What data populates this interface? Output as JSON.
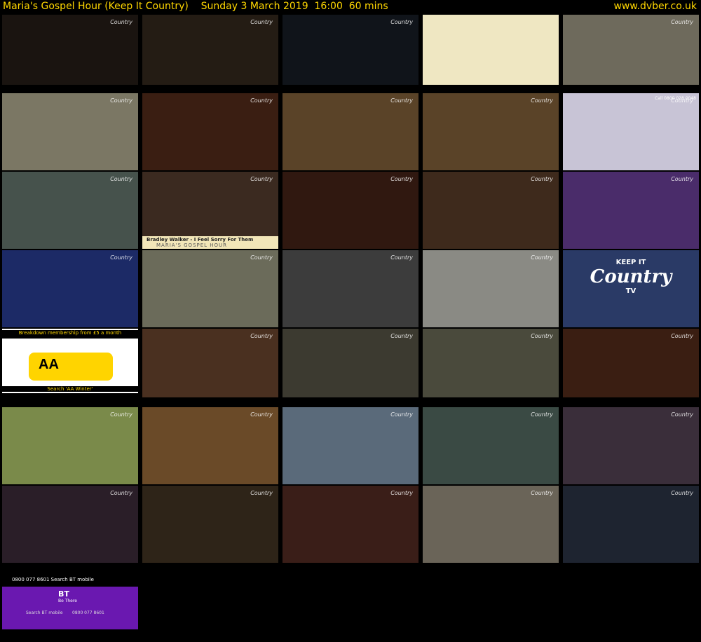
{
  "header": {
    "title": "Maria's Gospel Hour (Keep It Country)    Sunday 3 March 2019  16:00  60 mins",
    "site": "www.dvber.co.uk"
  },
  "channel_logo": "Country",
  "thumbnails": [
    {
      "name": "thumb-presenter-closeup",
      "bg": "#1a1410"
    },
    {
      "name": "thumb-guitarist-band",
      "bg": "#241c14"
    },
    {
      "name": "thumb-bass-player",
      "bg": "#10141a"
    },
    {
      "name": "thumb-bright-sunburst",
      "bg": "#efe7c2"
    },
    {
      "name": "thumb-man-rural-guitar",
      "bg": "#6e6a5c"
    },
    {
      "name": "thumb-couple-cottage",
      "bg": "#7b7764"
    },
    {
      "name": "thumb-maria-studio",
      "bg": "#3a1e12"
    },
    {
      "name": "thumb-singer-guitar",
      "bg": "#5a4328"
    },
    {
      "name": "thumb-singer-guitar-2",
      "bg": "#5a4328"
    },
    {
      "name": "thumb-advert-shelves",
      "bg": "#c8c4d6"
    },
    {
      "name": "thumb-child-hood",
      "bg": "#46524c"
    },
    {
      "name": "thumb-bradley-walker",
      "bg": "#3b2a20"
    },
    {
      "name": "thumb-singer-mic-red",
      "bg": "#301810"
    },
    {
      "name": "thumb-two-men-mic",
      "bg": "#3e2a1c"
    },
    {
      "name": "thumb-purple-guitar",
      "bg": "#4a2c6a"
    },
    {
      "name": "thumb-blue-guitar",
      "bg": "#1c2a66"
    },
    {
      "name": "thumb-old-man-outdoor",
      "bg": "#6b6b5a"
    },
    {
      "name": "thumb-bw-portrait",
      "bg": "#3c3c3c"
    },
    {
      "name": "thumb-bw-bench",
      "bg": "#8a8a84"
    },
    {
      "name": "thumb-keep-it-country-ident",
      "bg": "#2a3a66"
    },
    {
      "name": "thumb-aa-advert",
      "bg": "#ffffff"
    },
    {
      "name": "thumb-woman-singing",
      "bg": "#4a3020"
    },
    {
      "name": "thumb-woman-mic",
      "bg": "#3c3a30"
    },
    {
      "name": "thumb-woman-mic-2",
      "bg": "#4a4a3c"
    },
    {
      "name": "thumb-maria-studio-2",
      "bg": "#3a1e12"
    },
    {
      "name": "thumb-field-trio",
      "bg": "#7a8a4a"
    },
    {
      "name": "thumb-man-closeup-warm",
      "bg": "#6a4a28"
    },
    {
      "name": "thumb-living-room",
      "bg": "#5a6a7a"
    },
    {
      "name": "thumb-woman-studio",
      "bg": "#3a4a44"
    },
    {
      "name": "thumb-choir-stage",
      "bg": "#3a2e3a"
    },
    {
      "name": "thumb-singers-bearded",
      "bg": "#2a1e28"
    },
    {
      "name": "thumb-piano-party",
      "bg": "#2e2418"
    },
    {
      "name": "thumb-bearded-singer",
      "bg": "#3a1e18"
    },
    {
      "name": "thumb-elderly-woman",
      "bg": "#6a6458"
    },
    {
      "name": "thumb-three-men-suits",
      "bg": "#1e2430"
    },
    {
      "name": "thumb-bt-advert",
      "bg": "#6a18b0"
    }
  ],
  "overlays": {
    "aa_top": "Breakdown membership from £5 a month",
    "aa_logo": "AA",
    "aa_bottom": "Search 'AA Winter'",
    "bradley_caption": "Bradley Walker - I Feel Sorry For Them",
    "show_caption": "MARIA'S GOSPEL HOUR",
    "ktc_top": "KEEP IT",
    "ktc_main": "Country",
    "ktc_sub": "TV",
    "advert_phone": "Call 0800 028 0048",
    "bt_phone_top": "0800 077 8601   Search BT mobile",
    "bt_logo": "BT",
    "bt_tag": "Be There",
    "bt_search": "Search BT mobile",
    "bt_number": "0800 077 8601"
  }
}
